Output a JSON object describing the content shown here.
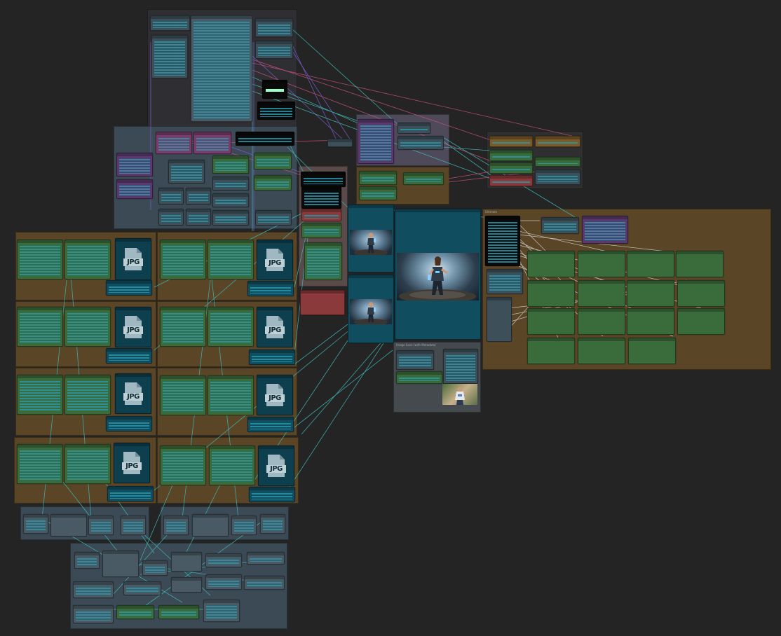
{
  "canvas": {
    "background": "#242424",
    "description_visible_text": "",
    "file_icon_label": "JPG",
    "group_titles": {
      "prompt_group": "",
      "loader_group": "",
      "output_group": "",
      "save_group": "Image Save (with Metadata)",
      "upscale_group": "Ultimate"
    }
  },
  "colors": {
    "node_green": "#3a6b3a",
    "node_teal": "#0f4d5f",
    "node_purple": "#5a3a6e",
    "node_pink": "#7a3d6b",
    "node_red": "#8a3a3a",
    "group_orange": "#5a4526",
    "group_slate": "#3b4a55",
    "wire_teal": "#3fb3b0",
    "wire_purple": "#7a5cc8",
    "wire_pink": "#c0507a",
    "wire_white": "#d8d8d8"
  }
}
